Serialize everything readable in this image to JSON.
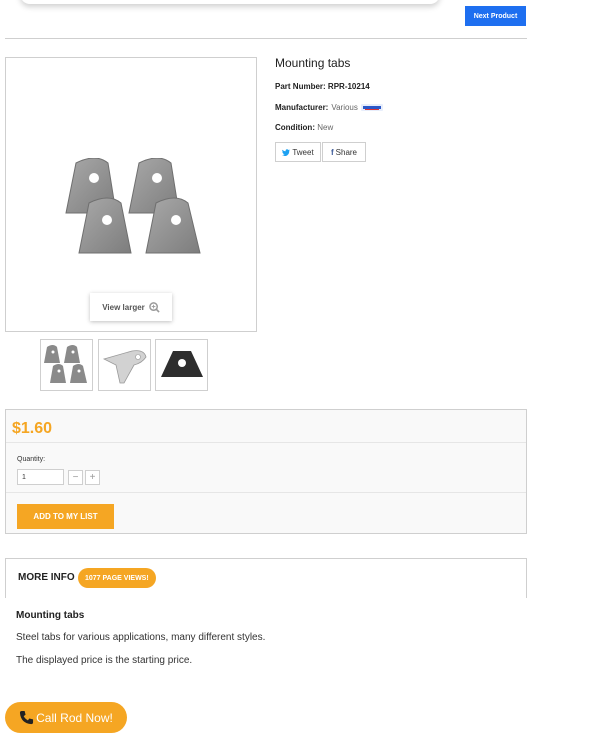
{
  "header": {
    "next_product_label": "Next Product"
  },
  "product": {
    "title": "Mounting tabs",
    "part_number_label": "Part Number:",
    "part_number": "RPR-10214",
    "manufacturer_label": "Manufacturer:",
    "manufacturer": "Various",
    "condition_label": "Condition:",
    "condition": "New"
  },
  "gallery": {
    "view_larger_label": "View larger",
    "thumbnails": [
      "four-tabs",
      "curved-tab",
      "trapezoid-tab"
    ]
  },
  "share": {
    "tweet_label": "Tweet",
    "share_label": "Share"
  },
  "pricing": {
    "price": "$1.60",
    "quantity_label": "Quantity:",
    "quantity_value": "1",
    "minus": "−",
    "plus": "+",
    "add_to_list_label": "ADD TO MY LIST"
  },
  "more_info": {
    "title": "MORE INFO",
    "views_badge": "1077 PAGE VIEWS!"
  },
  "description": {
    "title": "Mounting tabs",
    "line1": "Steel tabs for various applications, many different styles.",
    "line2": "The displayed price is the starting price."
  },
  "call": {
    "label": "Call Rod Now!"
  },
  "colors": {
    "accent": "#f5a623",
    "primary": "#1e6ff0",
    "border": "#cfcfcf"
  }
}
